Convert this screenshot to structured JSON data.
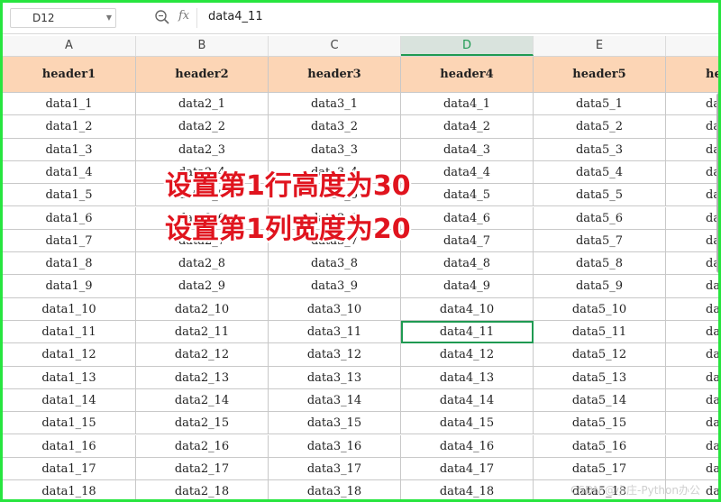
{
  "formula_bar": {
    "cell_ref": "D12",
    "fx_label": "fx",
    "content": "data4_11"
  },
  "columns": [
    "A",
    "B",
    "C",
    "D",
    "E"
  ],
  "selected_column": "D",
  "headers": [
    "header1",
    "header2",
    "header3",
    "header4",
    "header5",
    "he"
  ],
  "rows": [
    [
      "data1_1",
      "data2_1",
      "data3_1",
      "data4_1",
      "data5_1",
      "da"
    ],
    [
      "data1_2",
      "data2_2",
      "data3_2",
      "data4_2",
      "data5_2",
      "da"
    ],
    [
      "data1_3",
      "data2_3",
      "data3_3",
      "data4_3",
      "data5_3",
      "da"
    ],
    [
      "data1_4",
      "data2_4",
      "data3_4",
      "data4_4",
      "data5_4",
      "da"
    ],
    [
      "data1_5",
      "data2_5",
      "data3_5",
      "data4_5",
      "data5_5",
      "da"
    ],
    [
      "data1_6",
      "data2_6",
      "data3_6",
      "data4_6",
      "data5_6",
      "da"
    ],
    [
      "data1_7",
      "data2_7",
      "data3_7",
      "data4_7",
      "data5_7",
      "da"
    ],
    [
      "data1_8",
      "data2_8",
      "data3_8",
      "data4_8",
      "data5_8",
      "da"
    ],
    [
      "data1_9",
      "data2_9",
      "data3_9",
      "data4_9",
      "data5_9",
      "da"
    ],
    [
      "data1_10",
      "data2_10",
      "data3_10",
      "data4_10",
      "data5_10",
      "dat"
    ],
    [
      "data1_11",
      "data2_11",
      "data3_11",
      "data4_11",
      "data5_11",
      "dat"
    ],
    [
      "data1_12",
      "data2_12",
      "data3_12",
      "data4_12",
      "data5_12",
      "dat"
    ],
    [
      "data1_13",
      "data2_13",
      "data3_13",
      "data4_13",
      "data5_13",
      "dat"
    ],
    [
      "data1_14",
      "data2_14",
      "data3_14",
      "data4_14",
      "data5_14",
      "dat"
    ],
    [
      "data1_15",
      "data2_15",
      "data3_15",
      "data4_15",
      "data5_15",
      "dat"
    ],
    [
      "data1_16",
      "data2_16",
      "data3_16",
      "data4_16",
      "data5_16",
      "dat"
    ],
    [
      "data1_17",
      "data2_17",
      "data3_17",
      "data4_17",
      "data5_17",
      "dat"
    ],
    [
      "data1_18",
      "data2_18",
      "data3_18",
      "data4_18",
      "data5_18",
      "dat"
    ]
  ],
  "active_cell": "D12",
  "annotations": [
    "设置第1行高度为30",
    "设置第1列宽度为20"
  ],
  "watermark": "CSDN @小庄-Python办公",
  "colors": {
    "header_fill": "#fcd5b5",
    "selection_green": "#1f9a52",
    "annotation_red": "#e0141e",
    "frame_green": "#27e53f"
  },
  "icons": [
    "zoom-icon",
    "dropdown-caret-icon"
  ]
}
